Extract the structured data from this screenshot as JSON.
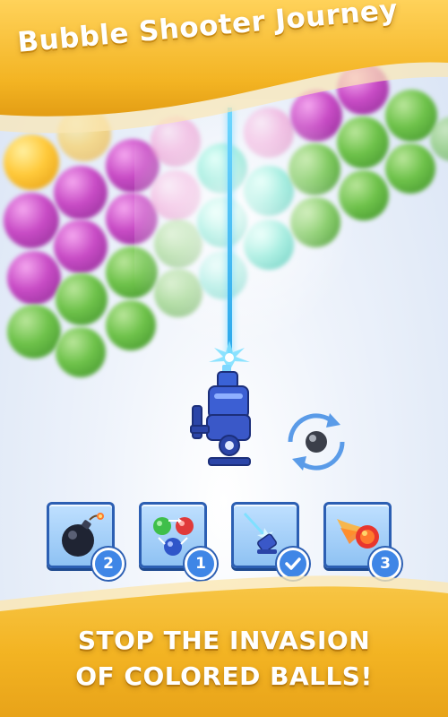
{
  "title": "Bubble Shooter Journey",
  "tagline": {
    "line1": "STOP THE INVASION",
    "line2": "OF COLORED BALLS!"
  },
  "boosters": [
    {
      "name": "bomb",
      "count": "2"
    },
    {
      "name": "color-swap",
      "count": "1"
    },
    {
      "name": "laser-aim",
      "status": "active"
    },
    {
      "name": "fireball",
      "count": "3"
    }
  ],
  "colors": {
    "banner_gold": "#f3b423",
    "booster_border": "#2c5fb3",
    "badge_blue": "#3f86e6",
    "laser": "#2aa7ea"
  }
}
